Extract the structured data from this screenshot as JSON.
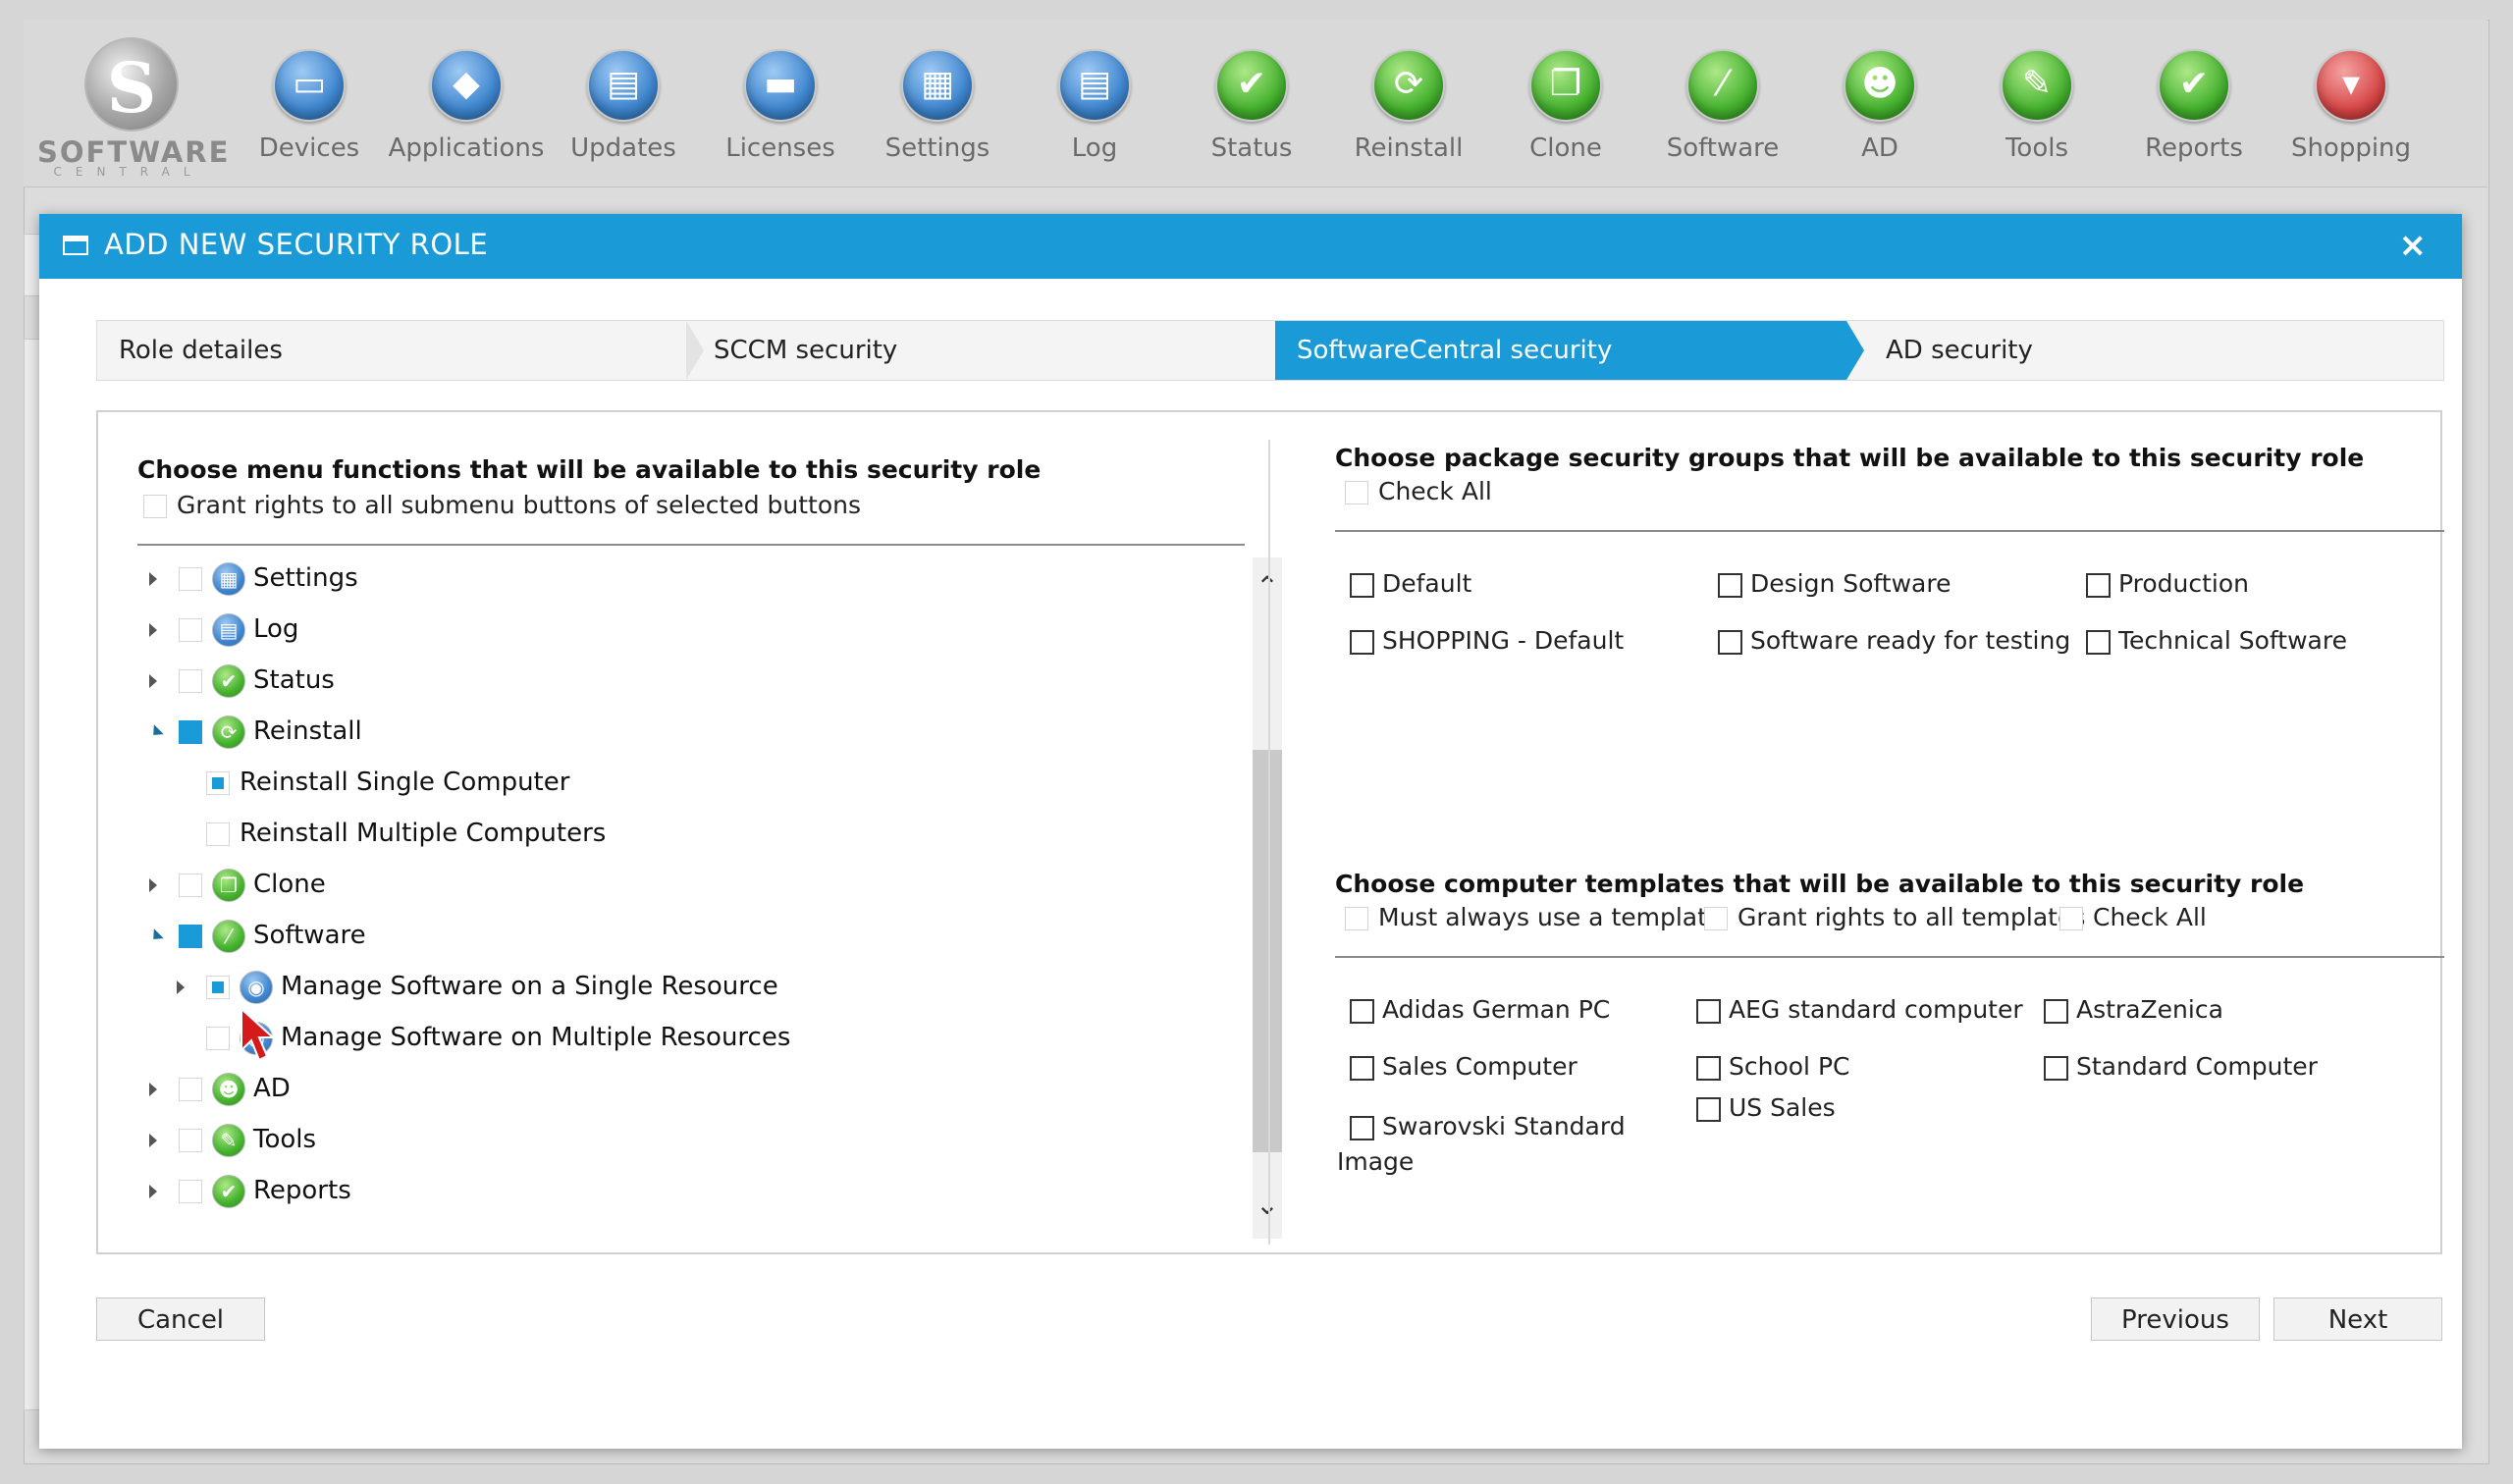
{
  "app": {
    "logo_word": "SOFTWARE",
    "logo_sub": "CENTRAL",
    "nav": [
      {
        "label": "Devices",
        "icon": "devices-icon",
        "color": "blue"
      },
      {
        "label": "Applications",
        "icon": "applications-icon",
        "color": "blue"
      },
      {
        "label": "Updates",
        "icon": "updates-icon",
        "color": "blue"
      },
      {
        "label": "Licenses",
        "icon": "licenses-icon",
        "color": "blue"
      },
      {
        "label": "Settings",
        "icon": "settings-icon",
        "color": "blue"
      },
      {
        "label": "Log",
        "icon": "log-icon",
        "color": "blue"
      },
      {
        "label": "Status",
        "icon": "status-icon",
        "color": "green"
      },
      {
        "label": "Reinstall",
        "icon": "reinstall-icon",
        "color": "green"
      },
      {
        "label": "Clone",
        "icon": "clone-icon",
        "color": "green"
      },
      {
        "label": "Software",
        "icon": "software-icon",
        "color": "green"
      },
      {
        "label": "AD",
        "icon": "ad-icon",
        "color": "green"
      },
      {
        "label": "Tools",
        "icon": "tools-icon",
        "color": "green"
      },
      {
        "label": "Reports",
        "icon": "reports-icon",
        "color": "green"
      },
      {
        "label": "Shopping",
        "icon": "shopping-icon",
        "color": "red"
      }
    ]
  },
  "dialog": {
    "title": "ADD NEW SECURITY ROLE",
    "close": "×",
    "steps": [
      "Role detailes",
      "SCCM security",
      "SoftwareCentral security",
      "AD security"
    ],
    "active_step": 2,
    "left": {
      "heading": "Choose menu functions that will be available to this security role",
      "grant_all": "Grant rights to all submenu buttons of selected buttons",
      "tree": [
        {
          "label": "Settings",
          "level": 0,
          "expand": "collapsed",
          "check": "none",
          "icon": "settings-icon"
        },
        {
          "label": "Log",
          "level": 0,
          "expand": "collapsed",
          "check": "none",
          "icon": "log-icon"
        },
        {
          "label": "Status",
          "level": 0,
          "expand": "collapsed",
          "check": "none",
          "icon": "status-icon"
        },
        {
          "label": "Reinstall",
          "level": 0,
          "expand": "expanded",
          "check": "full",
          "icon": "reinstall-icon"
        },
        {
          "label": "Reinstall Single Computer",
          "level": 1,
          "expand": "none",
          "check": "partial",
          "icon": ""
        },
        {
          "label": "Reinstall Multiple Computers",
          "level": 1,
          "expand": "none",
          "check": "none",
          "icon": ""
        },
        {
          "label": "Clone",
          "level": 0,
          "expand": "collapsed",
          "check": "none",
          "icon": "clone-icon"
        },
        {
          "label": "Software",
          "level": 0,
          "expand": "expanded",
          "check": "full",
          "icon": "software-icon"
        },
        {
          "label": "Manage Software on a Single Resource",
          "level": 1,
          "expand": "collapsed",
          "check": "partial",
          "icon": "manage-single-icon"
        },
        {
          "label": "Manage Software on Multiple Resources",
          "level": 1,
          "expand": "none",
          "check": "none",
          "icon": "manage-multiple-icon"
        },
        {
          "label": "AD",
          "level": 0,
          "expand": "collapsed",
          "check": "none",
          "icon": "ad-icon"
        },
        {
          "label": "Tools",
          "level": 0,
          "expand": "collapsed",
          "check": "none",
          "icon": "tools-icon"
        },
        {
          "label": "Reports",
          "level": 0,
          "expand": "collapsed",
          "check": "none",
          "icon": "reports-icon"
        }
      ]
    },
    "right": {
      "packages_heading": "Choose package security groups that will be available to this security role",
      "packages_check_all": "Check All",
      "packages": [
        "Default",
        "Design Software",
        "Production",
        "SHOPPING - Default",
        "Software ready for testing",
        "Technical Software"
      ],
      "templates_heading": "Choose computer templates that will be available to this security role",
      "must_use_template": "Must always use a template",
      "grant_all_templates": "Grant rights to all templates",
      "templates_check_all": "Check All",
      "templates": [
        "Adidas German PC",
        "AEG standard computer",
        "AstraZenica",
        "Sales Computer",
        "School PC",
        "Standard Computer",
        "Swarovski Standard Image",
        "US Sales"
      ]
    },
    "buttons": {
      "cancel": "Cancel",
      "previous": "Previous",
      "next": "Next"
    }
  }
}
